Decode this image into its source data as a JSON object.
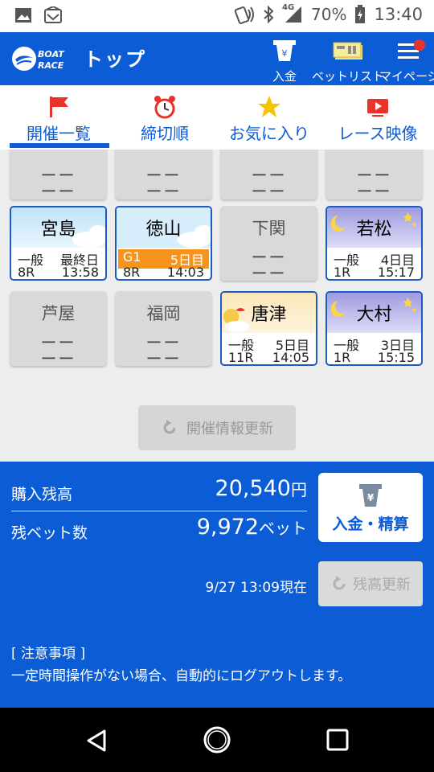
{
  "status_bar": {
    "network": "4G",
    "battery": "70%",
    "time": "13:40"
  },
  "header": {
    "title": "トップ",
    "logo_text": [
      "BOAT",
      "RACE"
    ],
    "buttons": [
      {
        "label": "入金",
        "icon": "deposit-icon"
      },
      {
        "label": "ベットリスト",
        "icon": "ticket-icon"
      },
      {
        "label": "マイページ",
        "icon": "menu-icon"
      }
    ]
  },
  "tabs": [
    {
      "label": "開催一覧",
      "icon": "flag-icon",
      "active": true
    },
    {
      "label": "締切順",
      "icon": "alarm-clock-icon"
    },
    {
      "label": "お気に入り",
      "icon": "star-icon"
    },
    {
      "label": "レース映像",
      "icon": "video-icon"
    }
  ],
  "venues_top_row": [
    {
      "dash1": "ーー",
      "dash2": "ーー"
    },
    {
      "dash1": "ーー",
      "dash2": "ーー"
    },
    {
      "dash1": "ーー",
      "dash2": "ーー"
    },
    {
      "dash1": "ーー",
      "dash2": "ーー"
    }
  ],
  "venues": [
    {
      "name": "宮島",
      "grade": "一般",
      "day": "最終日",
      "race": "8R",
      "time": "13:58",
      "open": true,
      "theme": "day"
    },
    {
      "name": "徳山",
      "grade": "G1",
      "day": "5日目",
      "race": "8R",
      "time": "14:03",
      "open": true,
      "theme": "day"
    },
    {
      "name": "下関",
      "dash1": "ーー",
      "dash2": "ーー",
      "open": false
    },
    {
      "name": "若松",
      "grade": "一般",
      "day": "4日目",
      "race": "1R",
      "time": "15:17",
      "open": true,
      "theme": "night"
    },
    {
      "name": "芦屋",
      "dash1": "ーー",
      "dash2": "ーー",
      "open": false
    },
    {
      "name": "福岡",
      "dash1": "ーー",
      "dash2": "ーー",
      "open": false
    },
    {
      "name": "唐津",
      "grade": "一般",
      "day": "5日目",
      "race": "11R",
      "time": "14:05",
      "open": true,
      "theme": "morning"
    },
    {
      "name": "大村",
      "grade": "一般",
      "day": "3日目",
      "race": "1R",
      "time": "15:15",
      "open": true,
      "theme": "night"
    }
  ],
  "refresh_button": "開催情報更新",
  "balance": {
    "purchase_label": "購入残高",
    "purchase_value": "20,540",
    "purchase_unit": "円",
    "bets_label": "残ベット数",
    "bets_value": "9,972",
    "bets_unit": "ベット",
    "deposit_button": "入金・精算",
    "timestamp": "9/27 13:09現在",
    "refresh_button": "残高更新"
  },
  "notice": {
    "title": "[ 注意事項 ]",
    "body": "一定時間操作がない場合、自動的にログアウトします。"
  },
  "colors": {
    "primary": "#0b5cd5",
    "g1_badge": "#f7941d",
    "card_gray": "#d9d9d9"
  }
}
